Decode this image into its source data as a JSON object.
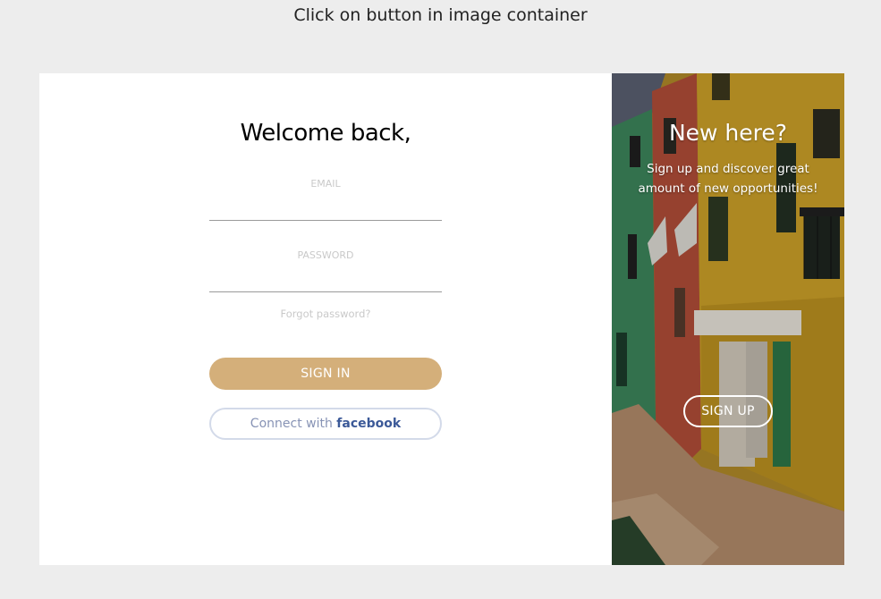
{
  "instruction": "Click on button in image container",
  "login": {
    "heading": "Welcome back,",
    "email_label": "EMAIL",
    "email_value": "",
    "password_label": "PASSWORD",
    "password_value": "",
    "forgot_label": "Forgot password?",
    "signin_label": "SIGN IN",
    "facebook_prefix": "Connect with ",
    "facebook_brand": "facebook"
  },
  "signup": {
    "title": "New here?",
    "description": "Sign up and discover great amount of new opportunities!",
    "button_label": "SIGN UP"
  },
  "colors": {
    "page_background": "#ededed",
    "accent": "#d4af7a",
    "facebook_border": "#d3dae9",
    "facebook_brand": "#3b5998"
  }
}
